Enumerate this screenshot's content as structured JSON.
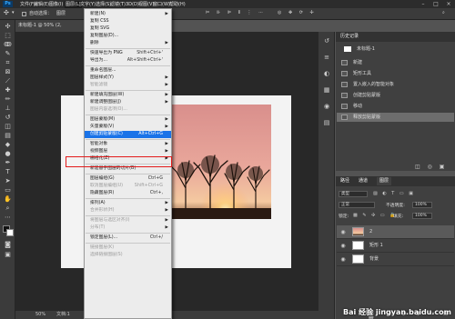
{
  "menubar": {
    "logo": "Ps",
    "items": [
      "文件(F)",
      "编辑(E)",
      "图像(I)",
      "图层(L)",
      "文字(Y)",
      "选择(S)",
      "滤镜(T)",
      "3D(D)",
      "视图(V)",
      "窗口(W)",
      "帮助(H)"
    ],
    "active_index": 3
  },
  "options_bar": {
    "auto_select_label": "自动选择：",
    "auto_select_value": "图层"
  },
  "document": {
    "tab_label": "未标题-1 @ 50% (2,",
    "zoom": "50%",
    "status_text": "文档:1"
  },
  "layer_menu": {
    "items": [
      {
        "label": "新建(N)",
        "arrow": true
      },
      {
        "label": "复制 CSS"
      },
      {
        "label": "复制 SVG"
      },
      {
        "label": "复制图层(D)..."
      },
      {
        "label": "删除",
        "arrow": true
      },
      {
        "sep": true
      },
      {
        "label": "快速导出为 PNG",
        "shortcut": "Shift+Ctrl+'"
      },
      {
        "label": "导出为...",
        "shortcut": "Alt+Shift+Ctrl+'"
      },
      {
        "sep": true
      },
      {
        "label": "重命名图层..."
      },
      {
        "label": "图层样式(Y)",
        "arrow": true
      },
      {
        "label": "智能滤镜",
        "disabled": true,
        "arrow": true
      },
      {
        "sep": true
      },
      {
        "label": "新建填充图层(W)",
        "arrow": true
      },
      {
        "label": "新建调整图层(J)",
        "arrow": true
      },
      {
        "label": "图层内容选项(O)...",
        "disabled": true
      },
      {
        "sep": true
      },
      {
        "label": "图层蒙版(M)",
        "arrow": true
      },
      {
        "label": "矢量蒙版(V)",
        "arrow": true
      },
      {
        "label": "创建剪贴蒙版(C)",
        "shortcut": "Alt+Ctrl+G",
        "highlight": true
      },
      {
        "sep": true
      },
      {
        "label": "智能对象",
        "arrow": true
      },
      {
        "label": "视频图层",
        "arrow": true
      },
      {
        "label": "栅格化(Z)",
        "arrow": true
      },
      {
        "sep": true
      },
      {
        "label": "新建基于图层的切片(B)"
      },
      {
        "sep": true
      },
      {
        "label": "图层编组(G)",
        "shortcut": "Ctrl+G"
      },
      {
        "label": "取消图层编组(U)",
        "shortcut": "Shift+Ctrl+G",
        "disabled": true
      },
      {
        "label": "隐藏图层(R)",
        "shortcut": "Ctrl+,"
      },
      {
        "sep": true
      },
      {
        "label": "排列(A)",
        "arrow": true
      },
      {
        "label": "合并形状(H)",
        "disabled": true,
        "arrow": true
      },
      {
        "sep": true
      },
      {
        "label": "将图层与选区对齐(I)",
        "disabled": true,
        "arrow": true
      },
      {
        "label": "分布(T)",
        "disabled": true,
        "arrow": true
      },
      {
        "sep": true
      },
      {
        "label": "锁定图层(L)...",
        "shortcut": "Ctrl+/"
      },
      {
        "sep": true
      },
      {
        "label": "链接图层(K)",
        "disabled": true
      },
      {
        "label": "选择链接图层(S)",
        "disabled": true
      }
    ]
  },
  "history_panel": {
    "tab_label": "历史记录",
    "snapshot_label": "未标题-1",
    "items": [
      "新建",
      "矩形工具",
      "置入嵌入的智能对象",
      "创建剪贴蒙版",
      "移动",
      "释放剪贴蒙版"
    ],
    "selected_index": 5
  },
  "layers_panel": {
    "tabs": [
      "路径",
      "通道",
      "图层"
    ],
    "active_tab_index": 2,
    "filter_value": "类型",
    "blend_mode": "正常",
    "opacity_label": "不透明度:",
    "opacity_value": "100%",
    "lock_label": "锁定:",
    "fill_label": "填充:",
    "fill_value": "100%",
    "layers": [
      {
        "name": "2",
        "kind": "image"
      },
      {
        "name": "矩形 1",
        "kind": "white"
      },
      {
        "name": "背景",
        "kind": "white"
      }
    ]
  },
  "colors": {
    "highlight": "#1a73e8",
    "red_box": "#e31b1b",
    "menu_bg": "#ececec"
  },
  "watermark": {
    "line": "Bai 经验 jingyan.baidu.com"
  }
}
